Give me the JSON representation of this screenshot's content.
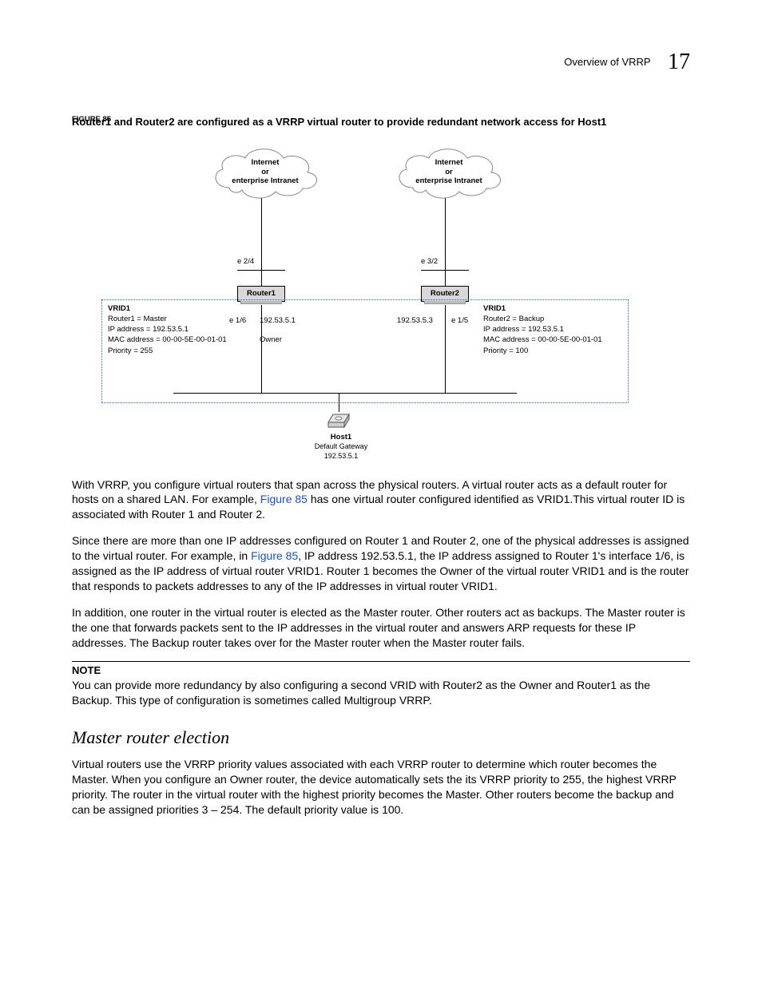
{
  "header": {
    "section": "Overview of VRRP",
    "chapter": "17"
  },
  "figure": {
    "label": "FIGURE 85",
    "caption": "Router1 and Router2 are configured as a VRRP virtual router to provide redundant network access for Host1"
  },
  "diagram": {
    "cloud": "Internet\nor\nenterprise Intranet",
    "port_r1_top": "e 2/4",
    "port_r2_top": "e 3/2",
    "router1": "Router1",
    "router2": "Router2",
    "port_r1_side": "e 1/6",
    "port_r2_side": "e 1/5",
    "ip_r1": "192.53.5.1",
    "ip_r2": "192.53.5.3",
    "owner": "Owner",
    "vrid1_left": {
      "title": "VRID1",
      "l1": "Router1 = Master",
      "l2": "IP address = 192.53.5.1",
      "l3": "MAC address = 00-00-5E-00-01-01",
      "l4": "Priority = 255"
    },
    "vrid1_right": {
      "title": "VRID1",
      "l1": "Router2 = Backup",
      "l2": "IP address = 192.53.5.1",
      "l3": "MAC address = 00-00-5E-00-01-01",
      "l4": "Priority = 100"
    },
    "host_title": "Host1",
    "host_l1": "Default Gateway",
    "host_l2": "192.53.5.1"
  },
  "para1a": "With VRRP, you configure virtual routers that span across the physical routers. A virtual router acts as a default router for hosts on a shared LAN. For example, ",
  "para1link": "Figure 85",
  "para1b": " has one virtual router configured identified as VRID1.This virtual router ID is associated with Router 1 and Router 2.",
  "para2a": "Since there are more than one IP addresses configured on Router 1 and Router 2, one of the physical addresses is assigned to the virtual router. For example, in ",
  "para2link": "Figure 85",
  "para2b": ", IP address 192.53.5.1, the IP address assigned to Router 1's interface 1/6, is assigned as the IP address of virtual router VRID1. Router 1 becomes the Owner of the virtual router VRID1 and is the router that responds to packets addresses to any of the IP addresses in virtual router VRID1.",
  "para3": "In addition, one router in the virtual router is elected as the Master router. Other routers act as backups. The Master router is the one that forwards packets sent to the IP addresses in the virtual router and answers ARP requests for these IP addresses. The Backup router takes over for the Master router when the Master router fails.",
  "note_hd": "NOTE",
  "note": "You can provide more redundancy by also configuring a second VRID with Router2 as the Owner and Router1 as the Backup.  This type of configuration is sometimes called Multigroup VRRP.",
  "h2": "Master router election",
  "para4": "Virtual routers use the VRRP priority values associated with each VRRP router to determine which router becomes the Master. When you configure an Owner router, the device automatically sets the its VRRP priority to 255, the highest VRRP priority. The router in the virtual router with the highest priority becomes the Master. Other routers become the backup and can be assigned priorities 3 – 254. The default priority value is 100."
}
